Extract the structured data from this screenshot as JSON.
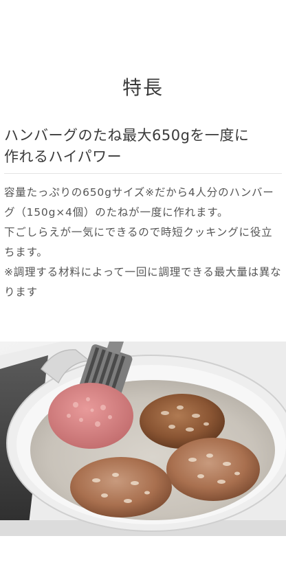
{
  "section": {
    "title": "特長"
  },
  "feature": {
    "headline_line1": "ハンバーグのたね最大650gを一度に",
    "headline_line2": "作れるハイパワー",
    "paragraphs": [
      "容量たっぷりの650gサイズ※だから4人分のハンバーグ（150g×4個）のたねが一度に作れます。",
      "下ごしらえが一気にできるので時短クッキングに役立ちます。",
      "※調理する材料によって一回に調理できる最大量は異なります"
    ]
  },
  "photo": {
    "subject": "frying-pan-with-hamburger-patties"
  }
}
